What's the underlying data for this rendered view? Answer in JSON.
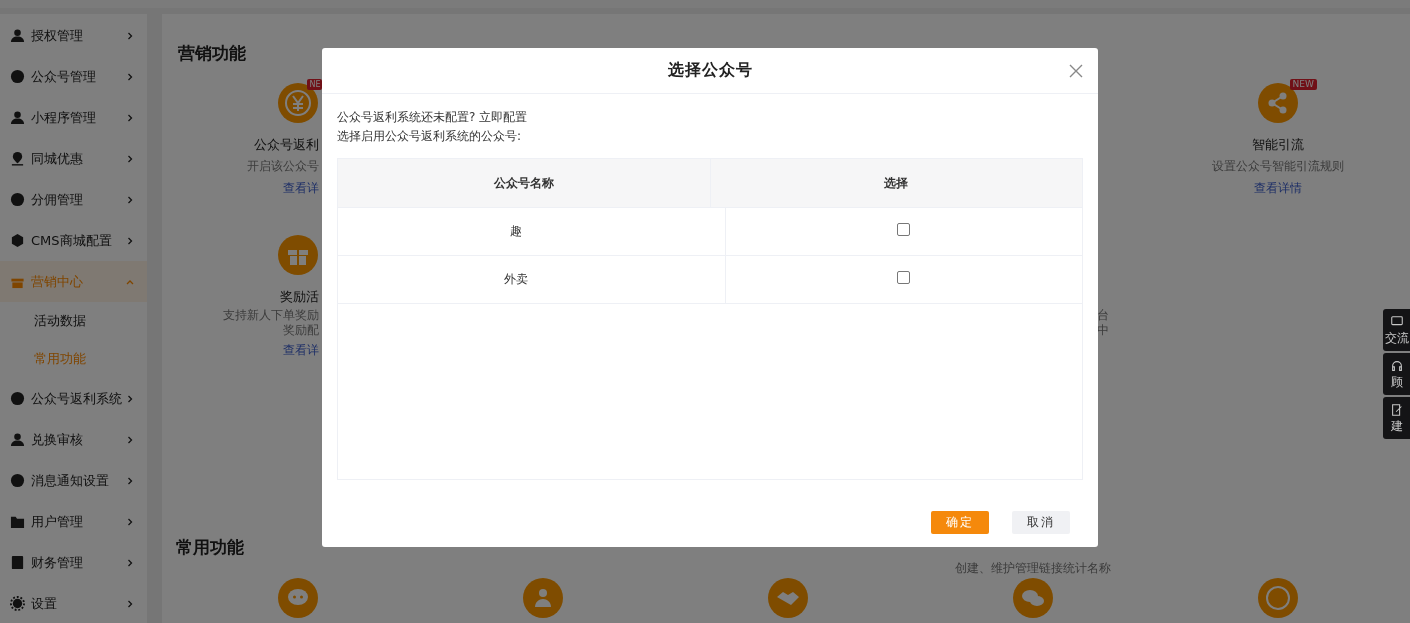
{
  "sidebar": {
    "items": [
      {
        "label": "授权管理",
        "selected": false,
        "expanded": false
      },
      {
        "label": "公众号管理",
        "selected": false,
        "expanded": false
      },
      {
        "label": "小程序管理",
        "selected": false,
        "expanded": false
      },
      {
        "label": "同城优惠",
        "selected": false,
        "expanded": false
      },
      {
        "label": "分佣管理",
        "selected": false,
        "expanded": false
      },
      {
        "label": "CMS商城配置",
        "selected": false,
        "expanded": false
      },
      {
        "label": "营销中心",
        "selected": true,
        "expanded": true,
        "children": [
          {
            "label": "活动数据",
            "selected": false
          },
          {
            "label": "常用功能",
            "selected": true
          }
        ]
      },
      {
        "label": "公众号返利系统",
        "selected": false,
        "expanded": false
      },
      {
        "label": "兑换审核",
        "selected": false,
        "expanded": false
      },
      {
        "label": "消息通知设置",
        "selected": false,
        "expanded": false
      },
      {
        "label": "用户管理",
        "selected": false,
        "expanded": false
      },
      {
        "label": "财务管理",
        "selected": false,
        "expanded": false
      },
      {
        "label": "设置",
        "selected": false,
        "expanded": false
      }
    ]
  },
  "marketing": {
    "title": "营销功能",
    "cards": [
      {
        "title": "公众号返利",
        "description": [
          "开启该公众号"
        ],
        "link": "查看详",
        "badge": "NE"
      },
      {
        "title": "智能引流",
        "description": [
          "设置公众号智能引流规则"
        ],
        "link": "查看详情",
        "badge": "NEW"
      },
      {
        "title": "奖励活",
        "description": [
          "支持新人下单奖励",
          "奖励配"
        ],
        "link": "查看详"
      },
      {
        "description": [
          "台",
          "中"
        ]
      },
      {
        "description": [
          "创建、维护管理链接统计名称"
        ]
      }
    ]
  },
  "common": {
    "title": "常用功能"
  },
  "float_tools": [
    {
      "label": "交流"
    },
    {
      "label": "顾"
    },
    {
      "label": "建"
    }
  ],
  "dialog": {
    "title": "选择公众号",
    "lines": [
      "公众号返利系统还未配置? 立即配置",
      "选择启用公众号返利系统的公众号:"
    ],
    "table": {
      "columns": [
        "公众号名称",
        "选择"
      ],
      "rows": [
        {
          "name": "趣",
          "checked": false
        },
        {
          "name": "外卖",
          "checked": false
        }
      ]
    },
    "buttons": [
      {
        "label": "确定",
        "kind": "primary"
      },
      {
        "label": "取消",
        "kind": "default"
      }
    ]
  }
}
